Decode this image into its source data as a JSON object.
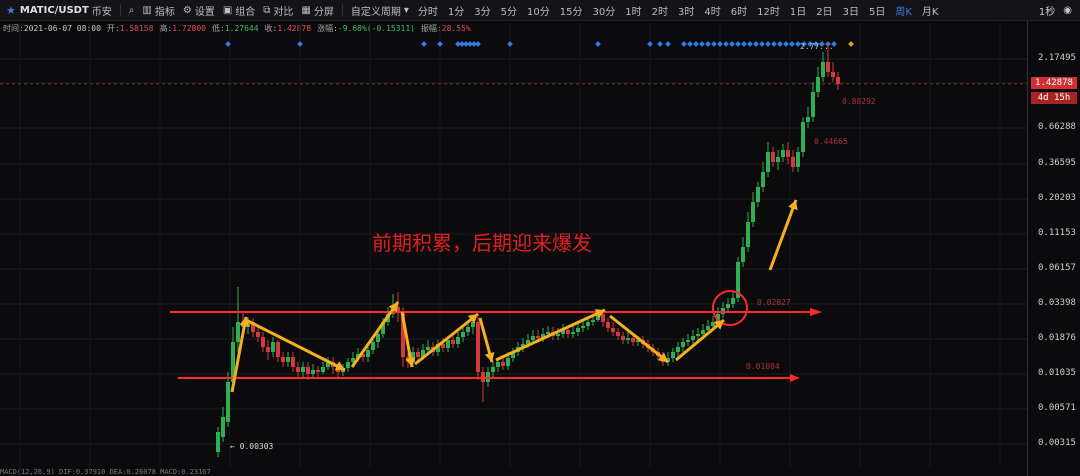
{
  "toolbar": {
    "symbol": "MATIC/USDT",
    "exchange": "币安",
    "indicators": "指标",
    "settings": "设置",
    "combo": "组合",
    "compare": "对比",
    "split": "分屏",
    "custom_period": "自定义周期",
    "periods": [
      "分时",
      "1分",
      "3分",
      "5分",
      "10分",
      "15分",
      "30分",
      "1时",
      "2时",
      "3时",
      "4时",
      "6时",
      "12时",
      "1日",
      "2日",
      "3日",
      "5日",
      "周K",
      "月K"
    ],
    "active_period": "周K",
    "refresh": "1秒"
  },
  "info": {
    "time_k": "时间:",
    "time_v": "2021-06-07 08:00",
    "open_k": "开:",
    "open_v": "1.58158",
    "high_k": "高:",
    "high_v": "1.72800",
    "low_k": "低:",
    "low_v": "1.27644",
    "close_k": "收:",
    "close_v": "1.42878",
    "chg_k": "涨幅:",
    "chg_v": "-9.68%(-0.15311)",
    "amp_k": "振幅:",
    "amp_v": "28.55%"
  },
  "axis": {
    "ticks": [
      "2.17495",
      "1.42878",
      "0.66288",
      "0.36595",
      "0.20203",
      "0.11153",
      "0.06157",
      "0.03398",
      "0.01876",
      "0.01035",
      "0.00571",
      "0.00315"
    ],
    "current_price": "1.42878",
    "countdown": "4d 15h"
  },
  "annotation": "前期积累，后期迎来爆发",
  "levels": {
    "l1": "0.88292",
    "l2": "0.44665",
    "l3": "0.02827",
    "l4": "0.01004",
    "low": "← 0.00303",
    "high": "2.77..."
  },
  "bottom": "MACD(12,26,9) DIF:0.37910 DEA:0.26078 MACD:0.23167",
  "colors": {
    "up": "#2fae54",
    "down": "#d33a3a",
    "arrow": "#f5b021",
    "line": "#ff2a2a",
    "marker": "#2f80ed"
  }
}
